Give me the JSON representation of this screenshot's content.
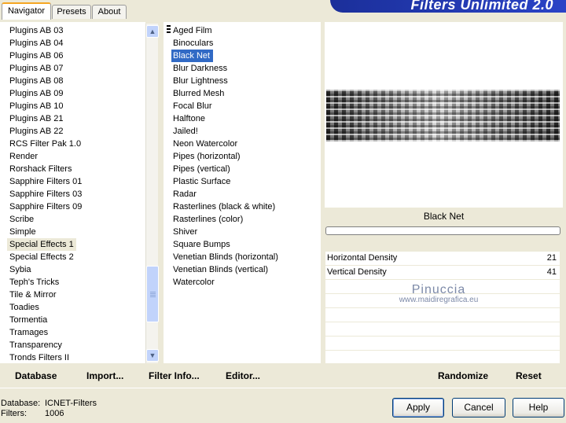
{
  "tabs": [
    {
      "label": "Navigator",
      "active": true
    },
    {
      "label": "Presets",
      "active": false
    },
    {
      "label": "About",
      "active": false
    }
  ],
  "app_title": "Filters Unlimited 2.0",
  "categories": [
    "Plugins AB 03",
    "Plugins AB 04",
    "Plugins AB 06",
    "Plugins AB 07",
    "Plugins AB 08",
    "Plugins AB 09",
    "Plugins AB 10",
    "Plugins AB 21",
    "Plugins AB 22",
    "RCS Filter Pak 1.0",
    "Render",
    "Rorshack Filters",
    "Sapphire Filters 01",
    "Sapphire Filters 03",
    "Sapphire Filters 09",
    "Scribe",
    "Simple",
    "Special Effects 1",
    "Special Effects 2",
    "Sybia",
    "Teph's Tricks",
    "Tile & Mirror",
    "Toadies",
    "Tormentia",
    "Tramages",
    "Transparency",
    "Tronds Filters II"
  ],
  "selected_category": "Special Effects 1",
  "filters": [
    "Aged Film",
    "Binoculars",
    "Black Net",
    "Blur Darkness",
    "Blur Lightness",
    "Blurred Mesh",
    "Focal Blur",
    "Halftone",
    "Jailed!",
    "Neon Watercolor",
    "Pipes (horizontal)",
    "Pipes (vertical)",
    "Plastic Surface",
    "Radar",
    "Rasterlines (black & white)",
    "Rasterlines (color)",
    "Shiver",
    "Square Bumps",
    "Venetian Blinds (horizontal)",
    "Venetian Blinds (vertical)",
    "Watercolor"
  ],
  "selected_filter": "Black Net",
  "preview_label": "Black Net",
  "parameters": [
    {
      "name": "Horizontal Density",
      "value": "21"
    },
    {
      "name": "Vertical Density",
      "value": "41"
    }
  ],
  "watermark": {
    "name": "Pinuccia",
    "site": "www.maidiregrafica.eu"
  },
  "left_buttons": {
    "database": "Database",
    "import": "Import...",
    "filter_info": "Filter Info...",
    "editor": "Editor..."
  },
  "right_buttons": {
    "randomize": "Randomize",
    "reset": "Reset"
  },
  "status": {
    "database_label": "Database:",
    "database_value": "ICNET-Filters",
    "filters_label": "Filters:",
    "filters_value": "1006"
  },
  "dialog_buttons": {
    "apply": "Apply",
    "cancel": "Cancel",
    "help": "Help"
  },
  "colors": {
    "selection_blue": "#316ac5",
    "title_blue": "#1b2f9a",
    "dialog_bg": "#ece9d8"
  }
}
